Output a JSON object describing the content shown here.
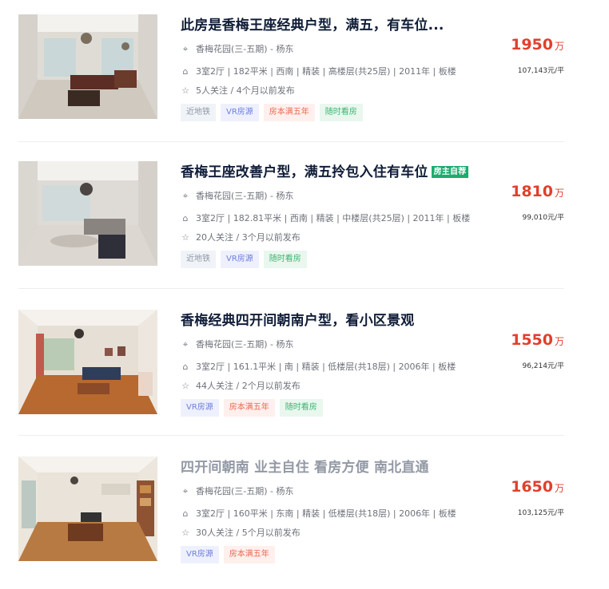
{
  "icons": {
    "location": "location-pin-icon",
    "house": "house-icon",
    "star": "star-icon"
  },
  "colors": {
    "price": "#e23f2c",
    "title": "#101d37",
    "owner_badge": "#1dac6f"
  },
  "listings": [
    {
      "title": "此房是香梅王座经典户型，满五，有车位...",
      "title_gray": false,
      "owner_badge": "",
      "address": "香梅花园(三-五期) - 杨东",
      "info": "3室2厅 | 182平米 | 西南 | 精装 | 高楼层(共25层) | 2011年 | 板楼",
      "follow": "5人关注 / 4个月以前发布",
      "price": "1950",
      "price_unit": "万",
      "unit_price": "107,143元/平",
      "tags": [
        {
          "label": "近地铁",
          "kind": "subway"
        },
        {
          "label": "VR房源",
          "kind": "vr"
        },
        {
          "label": "房本满五年",
          "kind": "five"
        },
        {
          "label": "随时看房",
          "kind": "anytime"
        }
      ]
    },
    {
      "title": "香梅王座改善户型，满五拎包入住有车位",
      "title_gray": false,
      "owner_badge": "房主自荐",
      "address": "香梅花园(三-五期) - 杨东",
      "info": "3室2厅 | 182.81平米 | 西南 | 精装 | 中楼层(共25层) | 2011年 | 板楼",
      "follow": "20人关注 / 3个月以前发布",
      "price": "1810",
      "price_unit": "万",
      "unit_price": "99,010元/平",
      "tags": [
        {
          "label": "近地铁",
          "kind": "subway"
        },
        {
          "label": "VR房源",
          "kind": "vr"
        },
        {
          "label": "随时看房",
          "kind": "anytime"
        }
      ]
    },
    {
      "title": "香梅经典四开间朝南户型，看小区景观",
      "title_gray": false,
      "owner_badge": "",
      "address": "香梅花园(三-五期) - 杨东",
      "info": "3室2厅 | 161.1平米 | 南 | 精装 | 低楼层(共18层) | 2006年 | 板楼",
      "follow": "44人关注 / 2个月以前发布",
      "price": "1550",
      "price_unit": "万",
      "unit_price": "96,214元/平",
      "tags": [
        {
          "label": "VR房源",
          "kind": "vr"
        },
        {
          "label": "房本满五年",
          "kind": "five"
        },
        {
          "label": "随时看房",
          "kind": "anytime"
        }
      ]
    },
    {
      "title": "四开间朝南 业主自住 看房方便 南北直通",
      "title_gray": true,
      "owner_badge": "",
      "address": "香梅花园(三-五期) - 杨东",
      "info": "3室2厅 | 160平米 | 东南 | 精装 | 低楼层(共18层) | 2006年 | 板楼",
      "follow": "30人关注 / 5个月以前发布",
      "price": "1650",
      "price_unit": "万",
      "unit_price": "103,125元/平",
      "tags": [
        {
          "label": "VR房源",
          "kind": "vr"
        },
        {
          "label": "房本满五年",
          "kind": "five"
        }
      ]
    }
  ]
}
